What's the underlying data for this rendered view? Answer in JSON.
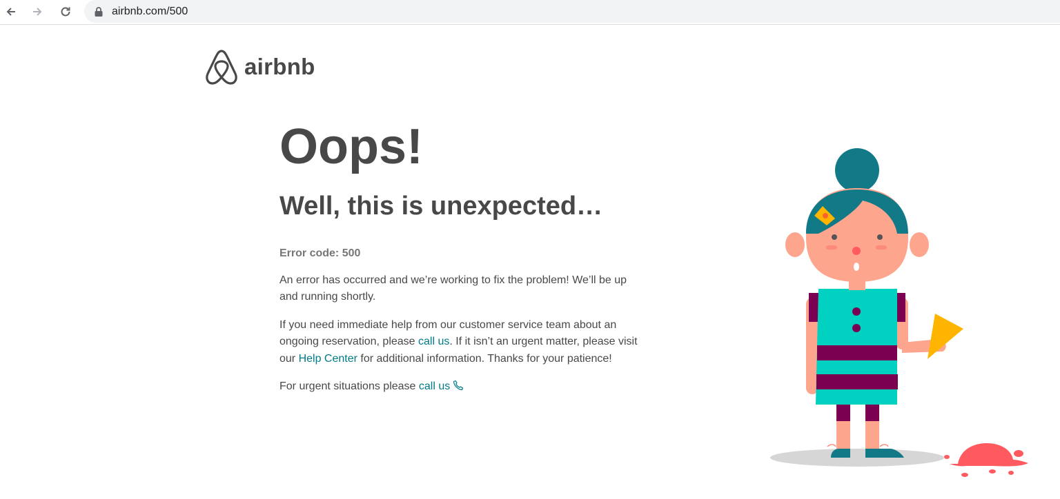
{
  "browser": {
    "url": "airbnb.com/500",
    "back_icon": "arrow-left-icon",
    "forward_icon": "arrow-right-icon",
    "reload_icon": "reload-icon",
    "lock_icon": "lock-icon"
  },
  "brand": {
    "name": "airbnb",
    "logo_icon": "airbnb-belo-icon",
    "color": "#484848"
  },
  "error": {
    "title": "Oops!",
    "subtitle": "Well, this is unexpected…",
    "code_label": "Error code: 500",
    "message": "An error has occurred and we’re working to fix the problem! We’ll be up and running shortly.",
    "help": {
      "text_1": "If you need immediate help from our customer service team about an ongoing reservation, please ",
      "link_call": "call us",
      "text_2": ". If it isn’t an urgent matter, please visit our ",
      "link_help_center": "Help Center",
      "text_3": " for additional information. Thanks for your patience!"
    },
    "urgent": {
      "text": "For urgent situations please ",
      "link_call": "call us",
      "icon": "phone-icon"
    }
  },
  "colors": {
    "link": "#007a87",
    "text": "#484848",
    "muted": "#767676"
  },
  "illustration": {
    "icon": "girl-with-dropped-ice-cream-illustration"
  }
}
